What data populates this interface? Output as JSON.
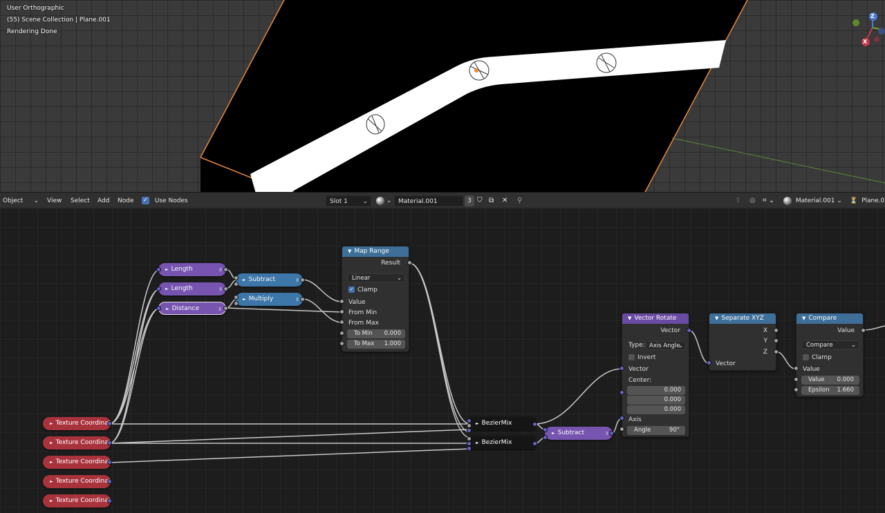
{
  "viewport": {
    "info_lines": [
      "User Orthographic",
      "(55) Scene Collection | Plane.001",
      "Rendering Done"
    ],
    "gizmo_axes": [
      "Z",
      "X"
    ]
  },
  "header": {
    "mode": "Object",
    "menus": [
      "View",
      "Select",
      "Add",
      "Node"
    ],
    "use_nodes_label": "Use Nodes",
    "slot": "Slot 1",
    "material": "Material.001",
    "users": "3",
    "right_material": "Material.001",
    "object": "Plane.0"
  },
  "nodes": {
    "map_range": {
      "title": "Map Range",
      "result": "Result",
      "interpolation": "Linear",
      "clamp": "Clamp",
      "value": "Value",
      "from_min": "From Min",
      "from_max": "From Max",
      "to_min_label": "To Min",
      "to_min": "0.000",
      "to_max_label": "To Max",
      "to_max": "1.000"
    },
    "vector_rotate": {
      "title": "Vector Rotate",
      "vector_out": "Vector",
      "type_label": "Type:",
      "type": "Axis Angle",
      "invert": "Invert",
      "vector_in": "Vector",
      "center": "Center:",
      "center_values": [
        "0.000",
        "0.000",
        "0.000"
      ],
      "axis": "Axis",
      "angle_label": "Angle",
      "angle": "90°"
    },
    "separate_xyz": {
      "title": "Separate XYZ",
      "x": "X",
      "y": "Y",
      "z": "Z",
      "vector": "Vector"
    },
    "compare": {
      "title": "Compare",
      "value_out": "Value",
      "operation": "Compare",
      "clamp": "Clamp",
      "value_in": "Value",
      "value_label": "Value",
      "value": "0.000",
      "epsilon_label": "Epsilon",
      "epsilon": "1.660"
    },
    "collapsed": {
      "length1": "Length",
      "length2": "Length",
      "distance": "Distance",
      "subtract1": "Subtract",
      "multiply": "Multiply",
      "bezier1": "BezierMix",
      "bezier2": "BezierMix",
      "subtract2": "Subtract",
      "tex": [
        "Texture Coordinat",
        "Texture Coordinat",
        "Texture Coordinat",
        "Texture Coordinat",
        "Texture Coordinat"
      ]
    }
  },
  "colors": {
    "accent": "#4772b3",
    "node_header_converter": "#3d6f98",
    "node_header_vector": "#6a4ba3",
    "input_node": "#a9333d",
    "selection_orange": "#e78a3a"
  }
}
